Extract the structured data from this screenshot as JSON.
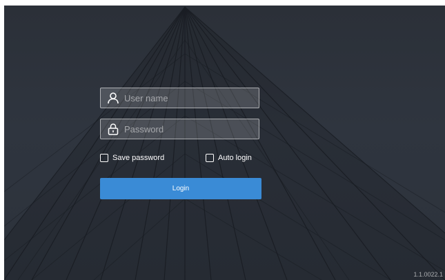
{
  "login": {
    "username_placeholder": "User name",
    "password_placeholder": "Password",
    "save_password_label": "Save password",
    "auto_login_label": "Auto login",
    "login_button_label": "Login"
  },
  "footer": {
    "version": "1.1.0022.1"
  },
  "colors": {
    "accent": "#3a8bd6",
    "background": "#2e343d"
  },
  "icons": {
    "username": "user-icon",
    "password": "lock-icon"
  }
}
